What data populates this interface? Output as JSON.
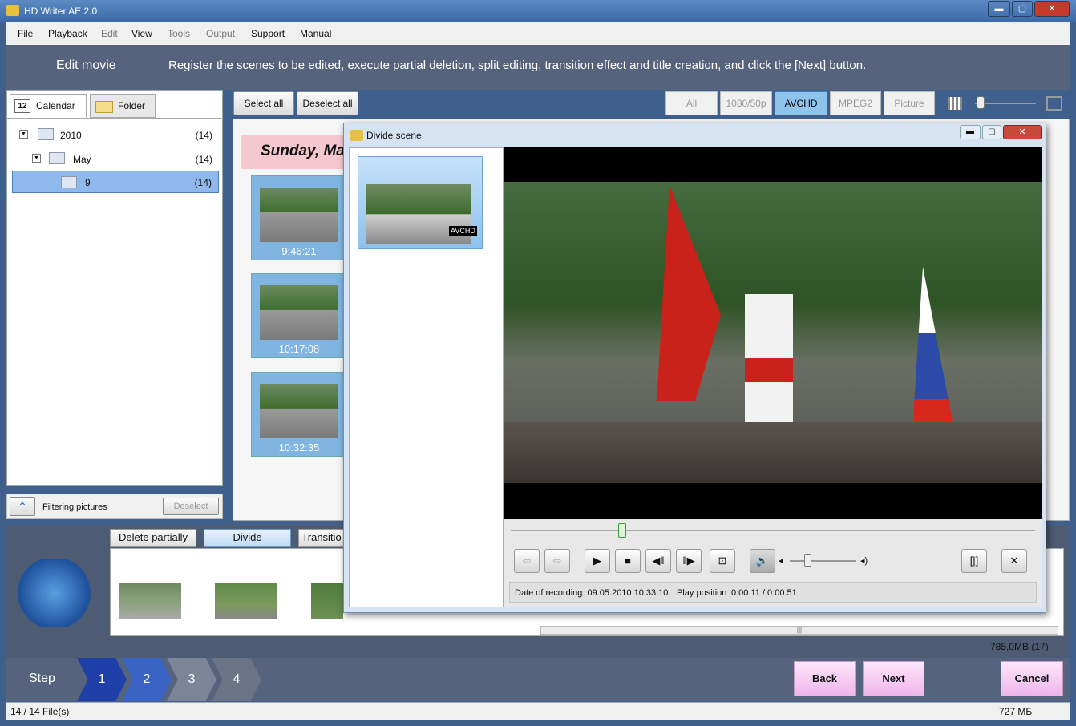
{
  "window": {
    "title": "HD Writer AE 2.0",
    "minimize": "▬",
    "maximize": "▢",
    "close": "✕"
  },
  "menu": [
    "File",
    "Playback",
    "Edit",
    "View",
    "Tools",
    "Output",
    "Support",
    "Manual"
  ],
  "header": {
    "section": "Edit movie",
    "instruction": "Register the scenes to be edited, execute partial deletion, split editing, transition effect and title creation, and click the [Next] button."
  },
  "left_tabs": {
    "calendar_icon": "12",
    "calendar": "Calendar",
    "folder": "Folder"
  },
  "tree": [
    {
      "label": "2010",
      "count": "(14)"
    },
    {
      "label": "May",
      "count": "(14)"
    },
    {
      "label": "9",
      "count": "(14)"
    }
  ],
  "filter": {
    "label": "Filtering pictures",
    "deselect": "Deselect"
  },
  "toolbar": {
    "select_all": "Select all",
    "deselect_all": "Deselect all",
    "filters": [
      "All",
      "1080/50p",
      "AVCHD",
      "MPEG2",
      "Picture"
    ],
    "active_filter": "AVCHD"
  },
  "date_banner": "Sunday, Ma",
  "thumbnails": [
    "9:46:21",
    "10:17:08",
    "10:32:35"
  ],
  "dialog": {
    "title": "Divide scene",
    "badge": "AVCHD",
    "recording_label": "Date of recording: 09.05.2010 10:33:10",
    "play_position_label": "Play position",
    "play_position_value": "0:00.11 / 0:00.51"
  },
  "edit_buttons": {
    "delete_partially": "Delete partially",
    "divide": "Divide",
    "transition": "Transitio"
  },
  "strip_scroll_glyph": "|||",
  "storage_size": "785,0MB (17)",
  "steps": {
    "label": "Step",
    "numbers": [
      "1",
      "2",
      "3",
      "4"
    ]
  },
  "nav": {
    "back": "Back",
    "next": "Next",
    "cancel": "Cancel"
  },
  "status": {
    "files": "14 / 14 File(s)",
    "disk": "727 МБ"
  },
  "colors": {
    "accent": "#3a69a8",
    "active_filter": "#8ec4ec",
    "step_active": "#1f3fa8",
    "nav_button": "#f0b5ea"
  }
}
